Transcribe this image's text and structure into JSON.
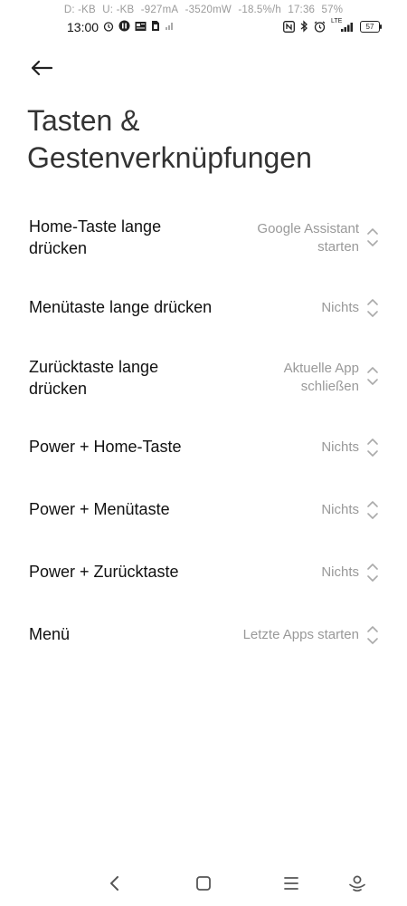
{
  "status_bar": {
    "download": "D: -KB",
    "upload": "U: -KB",
    "current": "-927mA",
    "power": "-3520mW",
    "drain": "-18.5%/h",
    "clock_right": "17:36",
    "battery_percent_top": "57%",
    "time": "13:00",
    "network_type": "LTE",
    "battery_level": "57",
    "icons_left": [
      "alarm-icon",
      "app-icon",
      "news-icon",
      "sim-icon",
      "signal-small-icon"
    ],
    "icons_right": [
      "nfc-icon",
      "bluetooth-icon",
      "alarm-icon",
      "lte-signal-icon",
      "battery-icon"
    ]
  },
  "header": {
    "back_icon": "back-arrow-icon",
    "title": "Tasten & Gestenverknüpfungen"
  },
  "settings": [
    {
      "label": "Home-Taste lange drücken",
      "value": "Google Assistant starten"
    },
    {
      "label": "Menütaste lange drücken",
      "value": "Nichts"
    },
    {
      "label": "Zurücktaste lange drücken",
      "value": "Aktuelle App schließen"
    },
    {
      "label": "Power + Home-Taste",
      "value": "Nichts"
    },
    {
      "label": "Power + Menütaste",
      "value": "Nichts"
    },
    {
      "label": "Power + Zurücktaste",
      "value": "Nichts"
    },
    {
      "label": "Menü",
      "value": "Letzte Apps starten"
    }
  ],
  "nav_bar": {
    "icons": [
      "nav-back-icon",
      "nav-home-icon",
      "nav-recents-icon",
      "nav-assistant-icon"
    ]
  }
}
